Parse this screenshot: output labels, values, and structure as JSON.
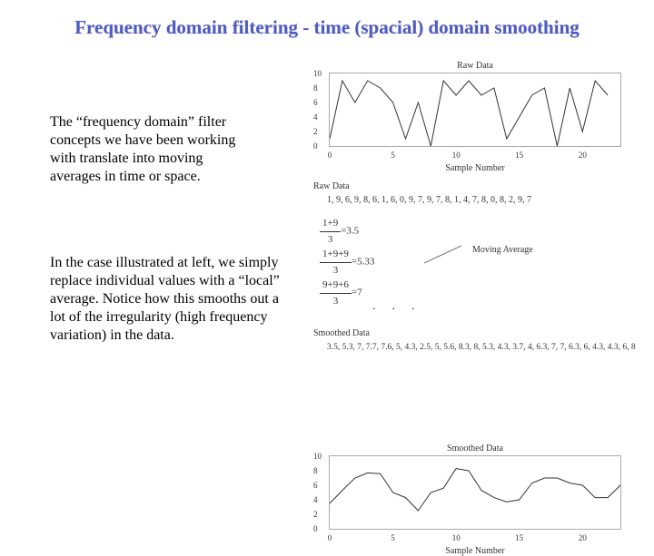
{
  "title": "Frequency domain filtering - time (spacial) domain smoothing",
  "para1": "The “frequency domain” filter concepts we have been working with translate into moving averages in time or space.",
  "para2": "In the case illustrated at left, we simply replace individual values with a “local” average. Notice how this smooths out a lot of the irregularity (high frequency variation) in the data.",
  "raw_data_label": "Raw Data",
  "raw_values_text": "1, 9, 6, 9, 8, 6, 1, 6, 0, 9, 7, 9, 7, 8, 1, 4, 7, 8, 0, 8, 2, 9, 7",
  "calc": {
    "r1_num": "1+9",
    "r1_den": "3",
    "r1_eq": "=3.5",
    "r2_num": "1+9+9",
    "r2_den": "3",
    "r2_eq": "=5.33",
    "r3_num": "9+9+6",
    "r3_den": "3",
    "r3_eq": "=7"
  },
  "moving_avg_label": "Moving Average",
  "smoothed_label": "Smoothed Data",
  "smoothed_values_text": "3.5, 5.3, 7, 7.7, 7.6, 5, 4.3, 2.5, 5, 5.6, 8.3, 8, 5.3, 4.3, 3.7, 4, 6.3, 7, 7, 6.3, 6, 4.3, 4.3, 6, 8",
  "chart_data": [
    {
      "type": "line",
      "title": "Raw Data",
      "xlabel": "Sample Number",
      "ylabel": "",
      "xlim": [
        0,
        23
      ],
      "ylim": [
        0,
        10
      ],
      "xticks": [
        0,
        5,
        10,
        15,
        20
      ],
      "yticks": [
        0,
        2,
        4,
        6,
        8,
        10
      ],
      "series": [
        {
          "name": "raw",
          "values": [
            1,
            9,
            6,
            9,
            8,
            6,
            1,
            6,
            0,
            9,
            7,
            9,
            7,
            8,
            1,
            4,
            7,
            8,
            0,
            8,
            2,
            9,
            7
          ]
        }
      ]
    },
    {
      "type": "line",
      "title": "Smoothed Data",
      "xlabel": "Sample Number",
      "ylabel": "",
      "xlim": [
        0,
        23
      ],
      "ylim": [
        0,
        10
      ],
      "xticks": [
        0,
        5,
        10,
        15,
        20
      ],
      "yticks": [
        0,
        2,
        4,
        6,
        8,
        10
      ],
      "series": [
        {
          "name": "smoothed",
          "values": [
            3.5,
            5.3,
            7,
            7.7,
            7.6,
            5,
            4.3,
            2.5,
            5,
            5.6,
            8.3,
            8,
            5.3,
            4.3,
            3.7,
            4,
            6.3,
            7,
            7,
            6.3,
            6,
            4.3,
            4.3,
            6,
            8
          ]
        }
      ]
    }
  ]
}
